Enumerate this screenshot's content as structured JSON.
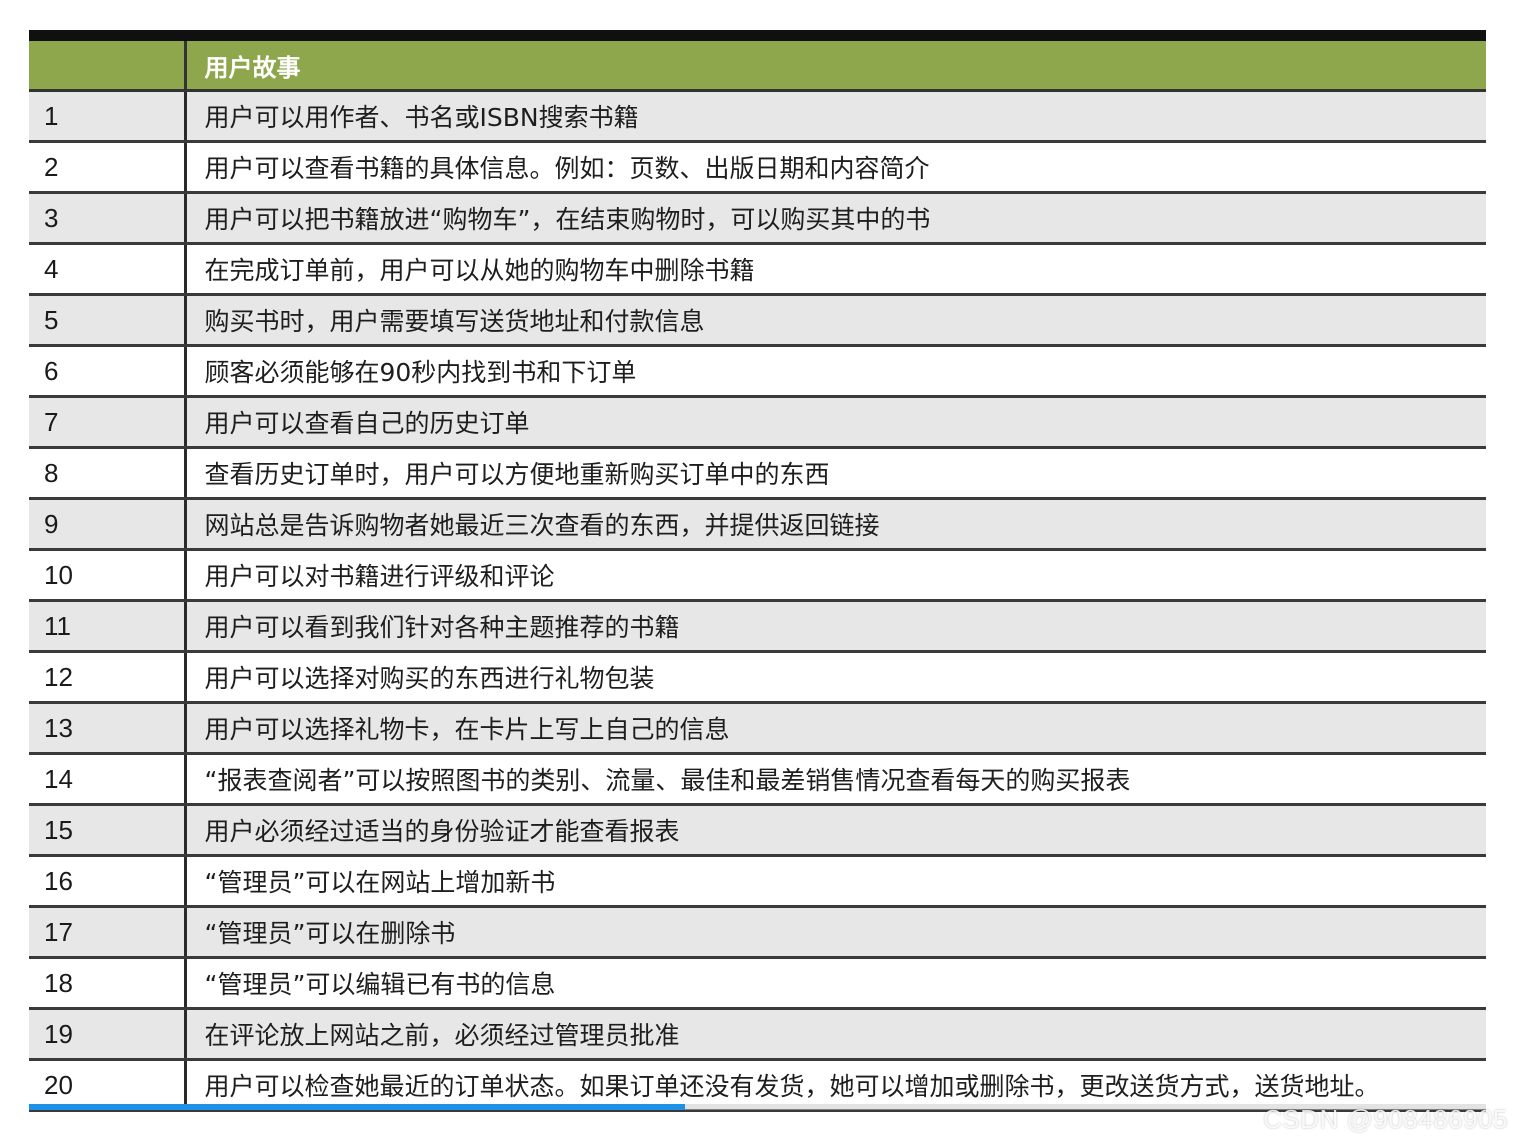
{
  "colors": {
    "header_bg": "#8ea64c",
    "header_text": "#ffffff",
    "row_alt_bg": "#e7e7e7",
    "row_bg": "#ffffff",
    "border": "#333333",
    "progress": "#1e90e6"
  },
  "table": {
    "header": {
      "number": "",
      "story": "用户故事"
    },
    "rows": [
      {
        "number": "1",
        "story": "用户可以用作者、书名或ISBN搜索书籍"
      },
      {
        "number": "2",
        "story": "用户可以查看书籍的具体信息。例如：页数、出版日期和内容简介"
      },
      {
        "number": "3",
        "story": "用户可以把书籍放进“购物车”，在结束购物时，可以购买其中的书"
      },
      {
        "number": "4",
        "story": "在完成订单前，用户可以从她的购物车中删除书籍"
      },
      {
        "number": "5",
        "story": "购买书时，用户需要填写送货地址和付款信息"
      },
      {
        "number": "6",
        "story": "顾客必须能够在90秒内找到书和下订单"
      },
      {
        "number": "7",
        "story": "用户可以查看自己的历史订单"
      },
      {
        "number": "8",
        "story": "查看历史订单时，用户可以方便地重新购买订单中的东西"
      },
      {
        "number": "9",
        "story": "网站总是告诉购物者她最近三次查看的东西，并提供返回链接"
      },
      {
        "number": "10",
        "story": "用户可以对书籍进行评级和评论"
      },
      {
        "number": "11",
        "story": "用户可以看到我们针对各种主题推荐的书籍"
      },
      {
        "number": "12",
        "story": "用户可以选择对购买的东西进行礼物包装"
      },
      {
        "number": "13",
        "story": "用户可以选择礼物卡，在卡片上写上自己的信息"
      },
      {
        "number": "14",
        "story": "“报表查阅者”可以按照图书的类别、流量、最佳和最差销售情况查看每天的购买报表"
      },
      {
        "number": "15",
        "story": "用户必须经过适当的身份验证才能查看报表"
      },
      {
        "number": "16",
        "story": "“管理员”可以在网站上增加新书"
      },
      {
        "number": "17",
        "story": "“管理员”可以在删除书"
      },
      {
        "number": "18",
        "story": "“管理员”可以编辑已有书的信息"
      },
      {
        "number": "19",
        "story": "在评论放上网站之前，必须经过管理员批准"
      },
      {
        "number": "20",
        "story": "用户可以检查她最近的订单状态。如果订单还没有发货，她可以增加或删除书，更改送货方式，送货地址。"
      }
    ]
  },
  "video_progress": 0.45,
  "watermark": "CSDN @908486905"
}
